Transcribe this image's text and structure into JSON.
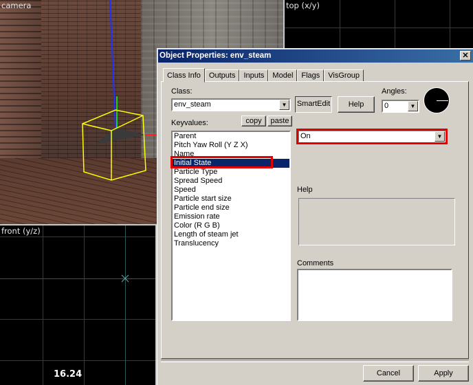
{
  "viewports": {
    "camera": "camera",
    "top": "top (x/y)",
    "front": "front (y/z)",
    "zoom": "16.24"
  },
  "dialog": {
    "title": "Object Properties: env_steam",
    "close_glyph": "✕",
    "tabs": [
      "Class Info",
      "Outputs",
      "Inputs",
      "Model",
      "Flags",
      "VisGroup"
    ],
    "active_tab": "Class Info",
    "class_label": "Class:",
    "class_value": "env_steam",
    "smartedit_label": "SmartEdit",
    "help_button_label": "Help",
    "angles_label": "Angles:",
    "angles_value": "0",
    "keyvalues_label": "Keyvalues:",
    "copy_label": "copy",
    "paste_label": "paste",
    "keyvalues": [
      "Parent",
      "Pitch Yaw Roll (Y Z X)",
      "Name",
      "Initial State",
      "Particle Type",
      "Spread Speed",
      "Speed",
      "Particle start size",
      "Particle end size",
      "Emission rate",
      "Color (R G B)",
      "Length of steam jet",
      "Translucency"
    ],
    "selected_keyvalue": "Initial State",
    "value_selected": "On",
    "help_section_label": "Help",
    "comments_label": "Comments",
    "cancel_label": "Cancel",
    "apply_label": "Apply"
  },
  "colors": {
    "titlebar_start": "#0a246a",
    "titlebar_end": "#3a6ea5",
    "selection": "#0a246a",
    "highlight_box": "#e00000",
    "dialog_face": "#d4d0c8"
  }
}
